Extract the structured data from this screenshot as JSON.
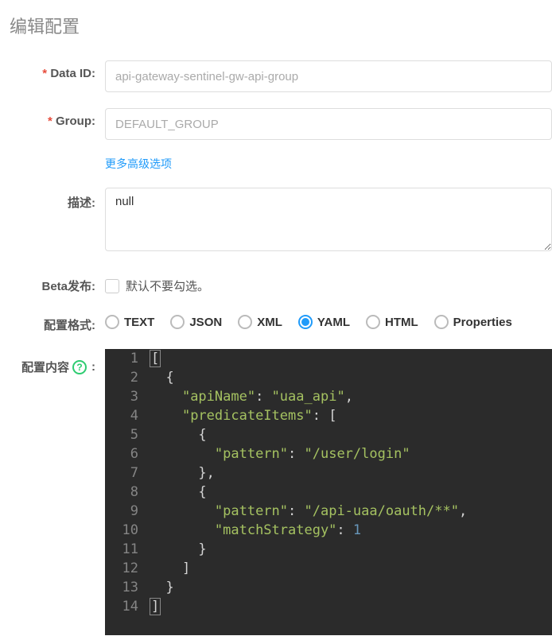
{
  "title": "编辑配置",
  "fields": {
    "dataId": {
      "label": "Data ID:",
      "value": "api-gateway-sentinel-gw-api-group"
    },
    "group": {
      "label": "Group:",
      "value": "DEFAULT_GROUP"
    },
    "advanced": "更多高级选项",
    "description": {
      "label": "描述:",
      "value": "null"
    },
    "beta": {
      "label": "Beta发布:",
      "hint": "默认不要勾选。"
    },
    "format": {
      "label": "配置格式:",
      "options": [
        "TEXT",
        "JSON",
        "XML",
        "YAML",
        "HTML",
        "Properties"
      ],
      "selected": "YAML"
    },
    "content": {
      "label": "配置内容"
    }
  },
  "editor": {
    "lines": [
      {
        "n": 1,
        "t": "[",
        "cursor": true
      },
      {
        "n": 2,
        "t": "  {"
      },
      {
        "n": 3,
        "t": "    \"apiName\": \"uaa_api\","
      },
      {
        "n": 4,
        "t": "    \"predicateItems\": ["
      },
      {
        "n": 5,
        "t": "      {"
      },
      {
        "n": 6,
        "t": "        \"pattern\": \"/user/login\""
      },
      {
        "n": 7,
        "t": "      },"
      },
      {
        "n": 8,
        "t": "      {"
      },
      {
        "n": 9,
        "t": "        \"pattern\": \"/api-uaa/oauth/**\","
      },
      {
        "n": 10,
        "t": "        \"matchStrategy\": 1"
      },
      {
        "n": 11,
        "t": "      }"
      },
      {
        "n": 12,
        "t": "    ]"
      },
      {
        "n": 13,
        "t": "  }"
      },
      {
        "n": 14,
        "t": "]",
        "cursor": true
      }
    ]
  }
}
